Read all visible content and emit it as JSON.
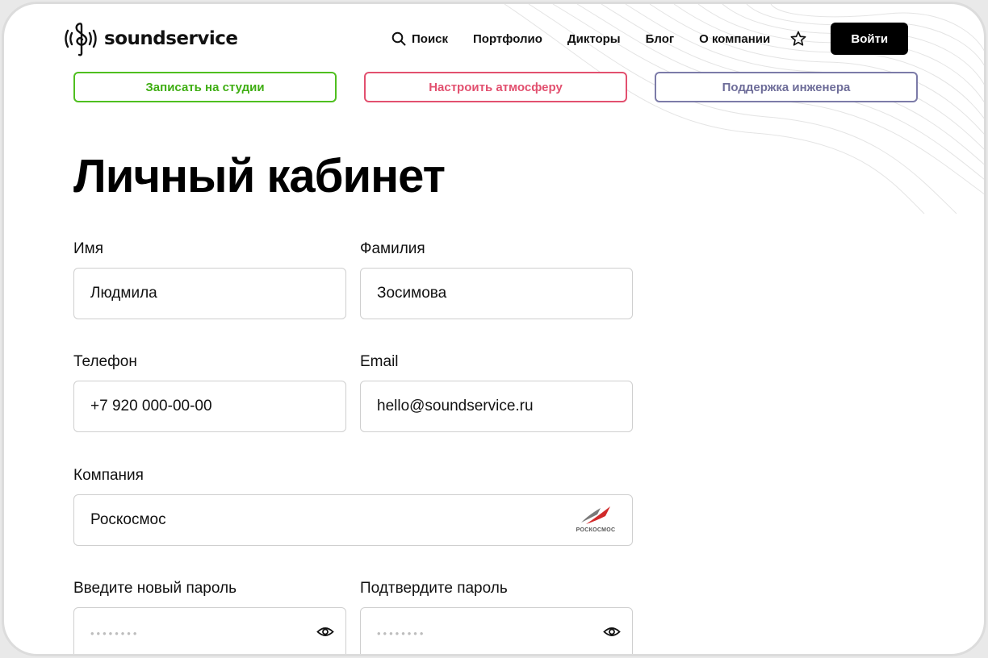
{
  "brand": {
    "name": "soundservice"
  },
  "nav": {
    "search": "Поиск",
    "portfolio": "Портфолио",
    "speakers": "Дикторы",
    "blog": "Блог",
    "about": "О компании",
    "login": "Войти"
  },
  "actions": {
    "record": "Записать на студии",
    "atmosphere": "Настроить атмосферу",
    "support": "Поддержка инженера"
  },
  "page": {
    "title": "Личный кабинет"
  },
  "form": {
    "first_name": {
      "label": "Имя",
      "value": "Людмила"
    },
    "last_name": {
      "label": "Фамилия",
      "value": "Зосимова"
    },
    "phone": {
      "label": "Телефон",
      "value": "+7 920 000-00-00"
    },
    "email": {
      "label": "Email",
      "value": "hello@soundservice.ru"
    },
    "company": {
      "label": "Компания",
      "value": "Роскосмос",
      "logo_text": "РОСКОСМОС"
    },
    "new_password": {
      "label": "Введите новый пароль",
      "value": "••••••••"
    },
    "confirm_password": {
      "label": "Подтвердите пароль",
      "value": "••••••••"
    }
  },
  "colors": {
    "accent_green": "#4fbf1f",
    "accent_pink": "#e2506f",
    "accent_violet": "#7c7ba8",
    "primary_button": "#000000"
  },
  "icons": {
    "logo": "treble-clef-sound-icon",
    "search": "search-icon",
    "favorite": "star-icon",
    "password_toggle": "eye-icon",
    "company": "roscosmos-logo"
  }
}
